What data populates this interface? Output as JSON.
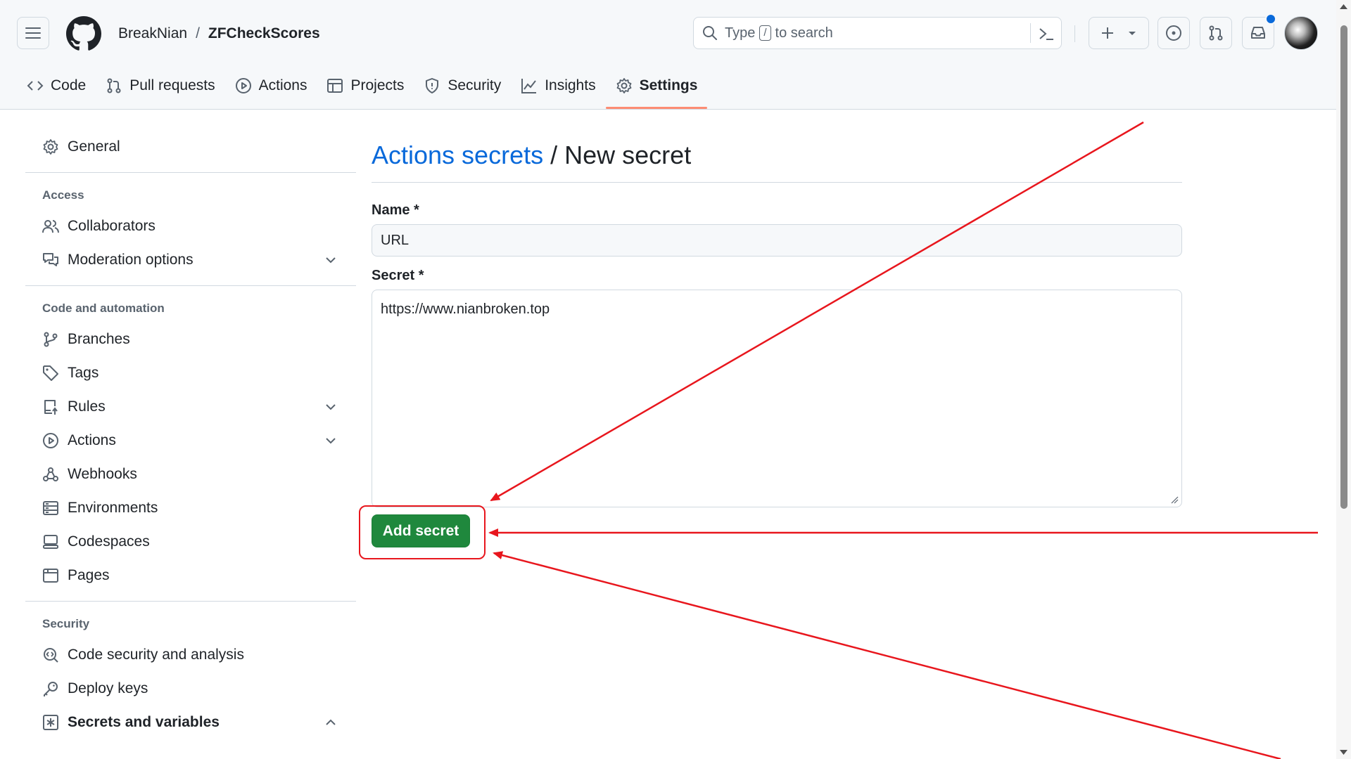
{
  "header": {
    "owner": "BreakNian",
    "separator": "/",
    "repo": "ZFCheckScores",
    "search_prefix": "Type",
    "search_key": "/",
    "search_suffix": "to search"
  },
  "tabs": [
    {
      "label": "Code",
      "icon": "code-icon"
    },
    {
      "label": "Pull requests",
      "icon": "pull-request-icon"
    },
    {
      "label": "Actions",
      "icon": "play-circle-icon"
    },
    {
      "label": "Projects",
      "icon": "table-icon"
    },
    {
      "label": "Security",
      "icon": "shield-icon"
    },
    {
      "label": "Insights",
      "icon": "graph-icon"
    },
    {
      "label": "Settings",
      "icon": "gear-icon",
      "selected": true
    }
  ],
  "sidebar": {
    "general": "General",
    "group_access": "Access",
    "collaborators": "Collaborators",
    "moderation": "Moderation options",
    "group_code": "Code and automation",
    "branches": "Branches",
    "tags": "Tags",
    "rules": "Rules",
    "actions": "Actions",
    "webhooks": "Webhooks",
    "environments": "Environments",
    "codespaces": "Codespaces",
    "pages": "Pages",
    "group_security": "Security",
    "code_security": "Code security and analysis",
    "deploy_keys": "Deploy keys",
    "secrets": "Secrets and variables"
  },
  "main": {
    "breadcrumb": "Actions secrets",
    "title_sep": "/",
    "title": "New secret",
    "name_label": "Name *",
    "name_value": "URL",
    "secret_label": "Secret *",
    "secret_value": "https://www.nianbroken.top",
    "add_button": "Add secret"
  },
  "colors": {
    "accent_link": "#0969da",
    "primary_button": "#1f883d",
    "annotation_red": "#e8161d",
    "selected_tab_underline": "#fd8c73"
  }
}
